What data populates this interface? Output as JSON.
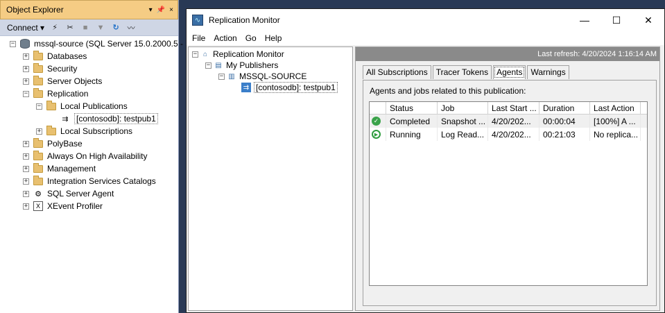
{
  "object_explorer": {
    "title": "Object Explorer",
    "title_controls": [
      "▾",
      "ᵖ",
      "×"
    ],
    "toolbar": {
      "connect_label": "Connect",
      "connect_arrow": "▾",
      "icons": [
        "connect-plug-icon",
        "disconnect-icon",
        "stop-icon",
        "filter-icon",
        "refresh-icon",
        "activity-monitor-icon"
      ]
    },
    "tree": {
      "root": "mssql-source (SQL Server 15.0.2000.5 -",
      "items": [
        {
          "label": "Databases",
          "expander": "+"
        },
        {
          "label": "Security",
          "expander": "+"
        },
        {
          "label": "Server Objects",
          "expander": "+"
        },
        {
          "label": "Replication",
          "expander": "−"
        },
        {
          "label": "Local Publications",
          "expander": "−"
        },
        {
          "label": "[contosodb]: testpub1",
          "expander": ""
        },
        {
          "label": "Local Subscriptions",
          "expander": "+"
        },
        {
          "label": "PolyBase",
          "expander": "+"
        },
        {
          "label": "Always On High Availability",
          "expander": "+"
        },
        {
          "label": "Management",
          "expander": "+"
        },
        {
          "label": "Integration Services Catalogs",
          "expander": "+"
        },
        {
          "label": "SQL Server Agent",
          "expander": "+"
        },
        {
          "label": "XEvent Profiler",
          "expander": "+"
        }
      ]
    }
  },
  "replication_monitor": {
    "title": "Replication Monitor",
    "window_controls": {
      "minimize": "—",
      "maximize": "☐",
      "close": "✕"
    },
    "menu": [
      "File",
      "Action",
      "Go",
      "Help"
    ],
    "tree": {
      "root": "Replication Monitor",
      "publishers": "My Publishers",
      "server": "MSSQL-SOURCE",
      "publication": "[contosodb]: testpub1"
    },
    "last_refresh": "Last refresh: 4/20/2024 1:16:14 AM",
    "tabs": [
      "All Subscriptions",
      "Tracer Tokens",
      "Agents",
      "Warnings"
    ],
    "active_tab": "Agents",
    "description": "Agents and jobs related to this publication:",
    "grid": {
      "columns": [
        "",
        "Status",
        "Job",
        "Last Start ...",
        "Duration",
        "Last Action"
      ],
      "rows": [
        {
          "status_icon": "completed-check-icon",
          "status": "Completed",
          "job": "Snapshot ...",
          "last_start": "4/20/202...",
          "duration": "00:00:04",
          "last_action": "[100%] A ..."
        },
        {
          "status_icon": "running-play-icon",
          "status": "Running",
          "job": "Log Read...",
          "last_start": "4/20/202...",
          "duration": "00:21:03",
          "last_action": "No replica..."
        }
      ]
    }
  }
}
